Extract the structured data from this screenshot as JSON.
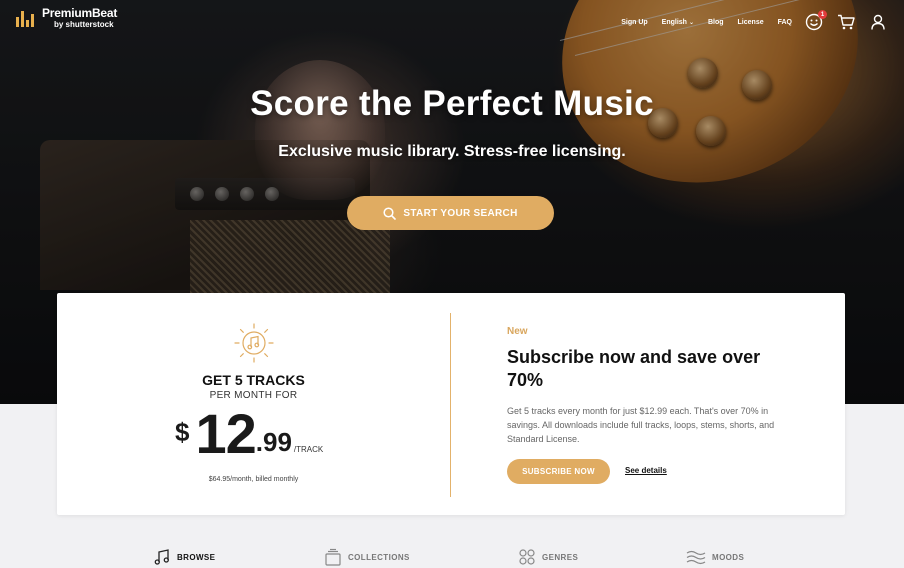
{
  "brand": {
    "name": "PremiumBeat",
    "sub": "by shutterstock",
    "accent_color": "#e0ac62"
  },
  "nav": {
    "sign_up": "Sign Up",
    "language": "English",
    "blog": "Blog",
    "license": "License",
    "faq": "FAQ",
    "notifications_count": "1",
    "icons": [
      "smiley-notification-icon",
      "cart-icon",
      "user-icon"
    ]
  },
  "hero": {
    "title": "Score the Perfect Music",
    "subtitle": "Exclusive music library. Stress-free licensing.",
    "search_button": "START YOUR SEARCH"
  },
  "offer": {
    "headline": "GET 5 TRACKS",
    "per_month": "PER MONTH FOR",
    "currency": "$",
    "price_whole": "12",
    "price_cents": ".99",
    "price_unit": "/TRACK",
    "billing": "$64.95/month, billed monthly",
    "new_label": "New",
    "subscribe_title": "Subscribe now and save over 70%",
    "subscribe_body": "Get 5 tracks every month for just $12.99 each. That's over 70% in savings. All downloads include full tracks, loops, stems, shorts, and Standard License.",
    "subscribe_button": "SUBSCRIBE NOW",
    "see_details": "See details"
  },
  "browse_nav": {
    "items": [
      {
        "label": "BROWSE",
        "icon": "music-note-icon",
        "active": true
      },
      {
        "label": "COLLECTIONS",
        "icon": "collections-icon",
        "active": false
      },
      {
        "label": "GENRES",
        "icon": "genres-icon",
        "active": false
      },
      {
        "label": "MOODS",
        "icon": "moods-icon",
        "active": false
      }
    ]
  }
}
